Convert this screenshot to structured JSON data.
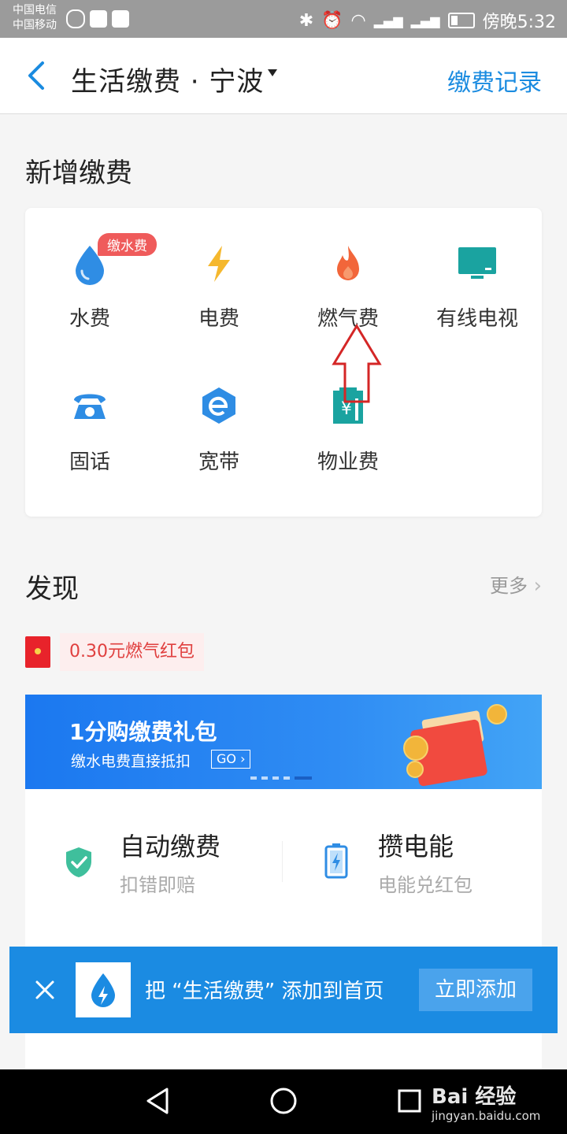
{
  "status_bar": {
    "carrier_1": "中国电信",
    "carrier_2": "中国移动",
    "time": "傍晚5:32"
  },
  "header": {
    "title": "生活缴费 · 宁波",
    "record_link": "缴费记录"
  },
  "new_payment": {
    "title": "新增缴费",
    "services": [
      {
        "label": "水费",
        "icon": "water-drop-icon",
        "color": "#2f8de4",
        "badge": "缴水费"
      },
      {
        "label": "电费",
        "icon": "lightning-icon",
        "color": "#f5b82e"
      },
      {
        "label": "燃气费",
        "icon": "flame-icon",
        "color": "#f2663a"
      },
      {
        "label": "有线电视",
        "icon": "tv-icon",
        "color": "#1aa3a0"
      },
      {
        "label": "固话",
        "icon": "telephone-icon",
        "color": "#2f8de4"
      },
      {
        "label": "宽带",
        "icon": "broadband-icon",
        "color": "#2f8de4"
      },
      {
        "label": "物业费",
        "icon": "property-building-icon",
        "color": "#1aa3a0"
      }
    ]
  },
  "discover": {
    "title": "发现",
    "more": "更多",
    "red_packet": "0.30元燃气红包"
  },
  "banner": {
    "title": "1分购缴费礼包",
    "subtitle": "缴水电费直接抵扣",
    "go": "GO"
  },
  "features": [
    {
      "title": "自动缴费",
      "subtitle": "扣错即赔",
      "icon": "shield-check-icon"
    },
    {
      "title": "攒电能",
      "subtitle": "电能兑红包",
      "icon": "battery-icon"
    }
  ],
  "add_bar": {
    "text": "把 “生活缴费” 添加到首页",
    "button": "立即添加"
  },
  "watermark": {
    "brand": "Bai 经验",
    "url": "jingyan.baidu.com"
  },
  "colors": {
    "accent": "#1a8be0",
    "add_bar": "#1b8be2",
    "badge": "#ef5b5b"
  }
}
